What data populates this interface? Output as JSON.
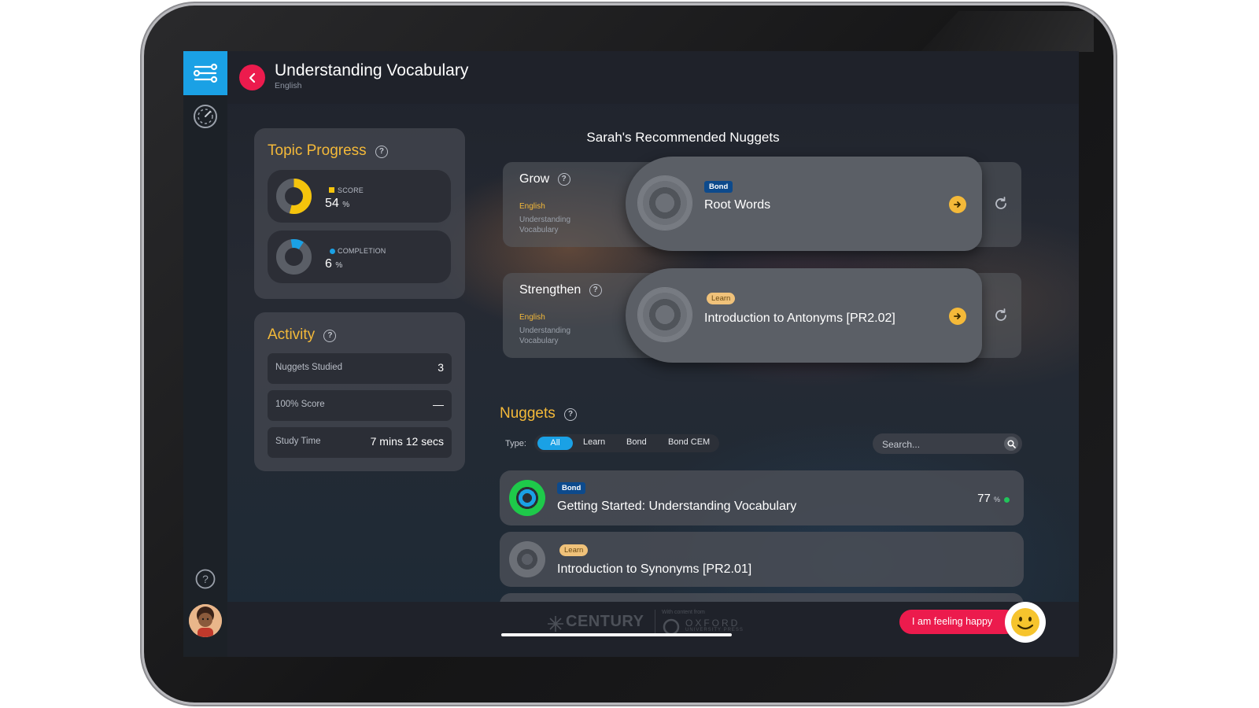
{
  "header": {
    "title": "Understanding Vocabulary",
    "subtitle": "English"
  },
  "topic_progress": {
    "title": "Topic Progress",
    "score": {
      "label": "SCORE",
      "value": "54",
      "unit": "%",
      "fraction": 0.54,
      "color": "#f5c40c"
    },
    "completion": {
      "label": "COMPLETION",
      "value": "6",
      "unit": "%",
      "fraction": 0.06,
      "color": "#1aa1e5"
    }
  },
  "activity": {
    "title": "Activity",
    "rows": [
      {
        "label": "Nuggets Studied",
        "value": "3"
      },
      {
        "label": "100% Score",
        "value": "—"
      },
      {
        "label": "Study Time",
        "value": "7 mins 12 secs"
      }
    ]
  },
  "recommended": {
    "title": "Sarah's Recommended Nuggets",
    "items": [
      {
        "category": "Grow",
        "subject": "English",
        "topic": "Understanding Vocabulary",
        "badge": "Bond",
        "name": "Root Words"
      },
      {
        "category": "Strengthen",
        "subject": "English",
        "topic": "Understanding Vocabulary",
        "badge": "Learn",
        "name": "Introduction to Antonyms [PR2.02]"
      }
    ]
  },
  "nuggets": {
    "title": "Nuggets",
    "type_label": "Type:",
    "filters": [
      "All",
      "Learn",
      "Bond",
      "Bond CEM"
    ],
    "search_placeholder": "Search...",
    "items": [
      {
        "badge": "Bond",
        "name": "Getting Started: Understanding Vocabulary",
        "score": "77",
        "unit": "%"
      },
      {
        "badge": "Learn",
        "name": "Introduction to Synonyms [PR2.01]"
      }
    ]
  },
  "footer": {
    "brand": "CENTURY",
    "partner_prefix": "With content from",
    "partner": "OXFORD",
    "partner_sub": "UNIVERSITY PRESS",
    "mood_button": "I am feeling happy"
  },
  "colors": {
    "accent_blue": "#1aa1e5",
    "accent_red": "#ec1b4d",
    "accent_gold": "#f4b939",
    "status_green": "#21c45a"
  },
  "icons": [
    "filter-sliders-icon",
    "dashboard-gauge-icon",
    "help-icon",
    "avatar",
    "chevron-left-icon",
    "arrow-right-icon",
    "refresh-icon",
    "search-icon",
    "smiley-icon"
  ]
}
